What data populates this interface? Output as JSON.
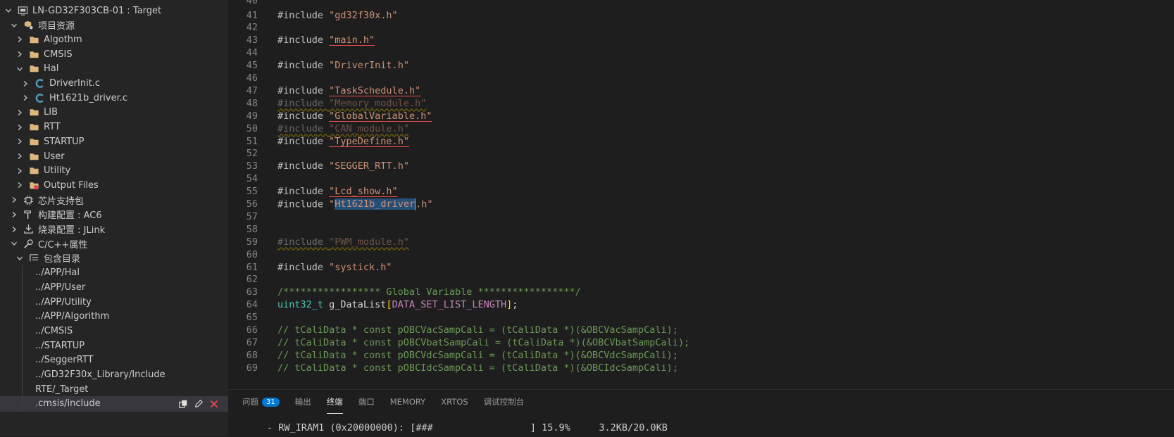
{
  "sidebar": {
    "rows": [
      {
        "label": "LN-GD32F303CB-01 : Target",
        "chev": "down",
        "icon": "project",
        "indent": 0
      },
      {
        "label": "项目资源",
        "chev": "down",
        "icon": "resources",
        "indent": 1
      },
      {
        "label": "Algothm",
        "chev": "right",
        "icon": "folder",
        "indent": 2
      },
      {
        "label": "CMSIS",
        "chev": "right",
        "icon": "folder",
        "indent": 2
      },
      {
        "label": "Hal",
        "chev": "down",
        "icon": "folder",
        "indent": 2
      },
      {
        "label": "DriverInit.c",
        "chev": "right",
        "icon": "c-file",
        "indent": 3
      },
      {
        "label": "Ht1621b_driver.c",
        "chev": "right",
        "icon": "c-file",
        "indent": 3
      },
      {
        "label": "LIB",
        "chev": "right",
        "icon": "folder",
        "indent": 2
      },
      {
        "label": "RTT",
        "chev": "right",
        "icon": "folder",
        "indent": 2
      },
      {
        "label": "STARTUP",
        "chev": "right",
        "icon": "folder",
        "indent": 2
      },
      {
        "label": "User",
        "chev": "right",
        "icon": "folder",
        "indent": 2
      },
      {
        "label": "Utility",
        "chev": "right",
        "icon": "folder",
        "indent": 2
      },
      {
        "label": "Output Files",
        "chev": "right",
        "icon": "output",
        "indent": 2
      },
      {
        "label": "芯片支持包",
        "chev": "right",
        "icon": "chip",
        "indent": 1
      },
      {
        "label": "构建配置 : AC6",
        "chev": "right",
        "icon": "hammer",
        "indent": 1
      },
      {
        "label": "烧录配置 : JLink",
        "chev": "right",
        "icon": "download",
        "indent": 1
      },
      {
        "label": "C/C++属性",
        "chev": "down",
        "icon": "wrench",
        "indent": 1
      },
      {
        "label": "包含目录",
        "chev": "down",
        "icon": "list",
        "indent": 2
      },
      {
        "label": "../APP/Hal",
        "chev": "none",
        "icon": "none",
        "indent": 3
      },
      {
        "label": "../APP/User",
        "chev": "none",
        "icon": "none",
        "indent": 3
      },
      {
        "label": "../APP/Utility",
        "chev": "none",
        "icon": "none",
        "indent": 3
      },
      {
        "label": "../APP/Algorithm",
        "chev": "none",
        "icon": "none",
        "indent": 3
      },
      {
        "label": "../CMSIS",
        "chev": "none",
        "icon": "none",
        "indent": 3
      },
      {
        "label": "../STARTUP",
        "chev": "none",
        "icon": "none",
        "indent": 3
      },
      {
        "label": "../SeggerRTT",
        "chev": "none",
        "icon": "none",
        "indent": 3
      },
      {
        "label": "../GD32F30x_Library/Include",
        "chev": "none",
        "icon": "none",
        "indent": 3
      },
      {
        "label": "RTE/_Target",
        "chev": "none",
        "icon": "none",
        "indent": 3
      },
      {
        "label": ".cmsis/include",
        "chev": "none",
        "icon": "none",
        "indent": 3,
        "selected": true
      }
    ]
  },
  "editor": {
    "partial_top_line": "40",
    "lines": [
      {
        "n": "41",
        "tokens": [
          {
            "t": "#include ",
            "c": "pp"
          },
          {
            "t": "\"gd32f30x.h\"",
            "c": "str"
          }
        ]
      },
      {
        "n": "42",
        "tokens": []
      },
      {
        "n": "43",
        "tokens": [
          {
            "t": "#include ",
            "c": "pp"
          },
          {
            "t": "\"main.h\"",
            "c": "str ul-red"
          }
        ]
      },
      {
        "n": "44",
        "tokens": []
      },
      {
        "n": "45",
        "tokens": [
          {
            "t": "#include ",
            "c": "pp"
          },
          {
            "t": "\"DriverInit.h\"",
            "c": "str"
          }
        ]
      },
      {
        "n": "46",
        "tokens": []
      },
      {
        "n": "47",
        "tokens": [
          {
            "t": "#include ",
            "c": "pp"
          },
          {
            "t": "\"TaskSchedule.h\"",
            "c": "str ul-red"
          }
        ]
      },
      {
        "n": "48",
        "tokens": [
          {
            "t": "#include ",
            "c": "pp dim ul-yel"
          },
          {
            "t": "\"Memory_module.h\"",
            "c": "str dim ul-yel"
          }
        ]
      },
      {
        "n": "49",
        "tokens": [
          {
            "t": "#include ",
            "c": "pp"
          },
          {
            "t": "\"GlobalVariable.h\"",
            "c": "str ul-red"
          }
        ]
      },
      {
        "n": "50",
        "tokens": [
          {
            "t": "#include ",
            "c": "pp dim ul-yel"
          },
          {
            "t": "\"CAN_module.h\"",
            "c": "str dim ul-yel"
          }
        ]
      },
      {
        "n": "51",
        "tokens": [
          {
            "t": "#include ",
            "c": "pp"
          },
          {
            "t": "\"TypeDefine.h\"",
            "c": "str ul-red"
          }
        ]
      },
      {
        "n": "52",
        "tokens": []
      },
      {
        "n": "53",
        "tokens": [
          {
            "t": "#include ",
            "c": "pp"
          },
          {
            "t": "\"SEGGER_RTT.h\"",
            "c": "str"
          }
        ]
      },
      {
        "n": "54",
        "tokens": []
      },
      {
        "n": "55",
        "tokens": [
          {
            "t": "#include ",
            "c": "pp"
          },
          {
            "t": "\"Lcd_show.h\"",
            "c": "str ul-red"
          }
        ]
      },
      {
        "n": "56",
        "tokens": [
          {
            "t": "#include ",
            "c": "pp"
          },
          {
            "t": "\"",
            "c": "str"
          },
          {
            "t": "Ht1621b_driver",
            "c": "str sel"
          },
          {
            "t": "CURSOR",
            "c": "cursor"
          },
          {
            "t": ".h\"",
            "c": "str"
          }
        ]
      },
      {
        "n": "57",
        "tokens": []
      },
      {
        "n": "58",
        "tokens": []
      },
      {
        "n": "59",
        "tokens": [
          {
            "t": "#include ",
            "c": "pp dim ul-yel"
          },
          {
            "t": "\"PWM_module.h\"",
            "c": "str dim ul-yel"
          }
        ]
      },
      {
        "n": "60",
        "tokens": []
      },
      {
        "n": "61",
        "tokens": [
          {
            "t": "#include ",
            "c": "pp"
          },
          {
            "t": "\"systick.h\"",
            "c": "str"
          }
        ]
      },
      {
        "n": "62",
        "tokens": []
      },
      {
        "n": "63",
        "tokens": [
          {
            "t": "/***************** Global Variable *****************/",
            "c": "cm"
          }
        ]
      },
      {
        "n": "64",
        "tokens": [
          {
            "t": "uint32_t",
            "c": "ty"
          },
          {
            "t": " g_DataList",
            "c": "var"
          },
          {
            "t": "[",
            "c": "brk"
          },
          {
            "t": "DATA_SET_LIST_LENGTH",
            "c": "mac"
          },
          {
            "t": "]",
            "c": "brk"
          },
          {
            "t": ";",
            "c": "var"
          }
        ]
      },
      {
        "n": "65",
        "tokens": []
      },
      {
        "n": "66",
        "tokens": [
          {
            "t": "// tCaliData * const pOBCVacSampCali = (tCaliData *)(&OBCVacSampCali);",
            "c": "cm"
          }
        ]
      },
      {
        "n": "67",
        "tokens": [
          {
            "t": "// tCaliData * const pOBCVbatSampCali = (tCaliData *)(&OBCVbatSampCali);",
            "c": "cm"
          }
        ]
      },
      {
        "n": "68",
        "tokens": [
          {
            "t": "// tCaliData * const pOBCVdcSampCali = (tCaliData *)(&OBCVdcSampCali);",
            "c": "cm"
          }
        ]
      },
      {
        "n": "69",
        "tokens": [
          {
            "t": "// tCaliData * const pOBCIdcSampCali = (tCaliData *)(&OBCIdcSampCali);",
            "c": "cm"
          }
        ]
      }
    ]
  },
  "panel": {
    "tabs": [
      {
        "label": "问题",
        "badge": "31",
        "active": false
      },
      {
        "label": "输出",
        "active": false
      },
      {
        "label": "终端",
        "active": true
      },
      {
        "label": "端口",
        "active": false
      },
      {
        "label": "MEMORY",
        "active": false
      },
      {
        "label": "XRTOS",
        "active": false
      },
      {
        "label": "调试控制台",
        "active": false
      }
    ],
    "terminal_text": "- RW_IRAM1 (0x20000000): [###                 ] 15.9%     3.2KB/20.0KB"
  },
  "colors": {
    "accent": "#0078d4",
    "folder": "#dcb67a",
    "c_file": "#519aba"
  }
}
